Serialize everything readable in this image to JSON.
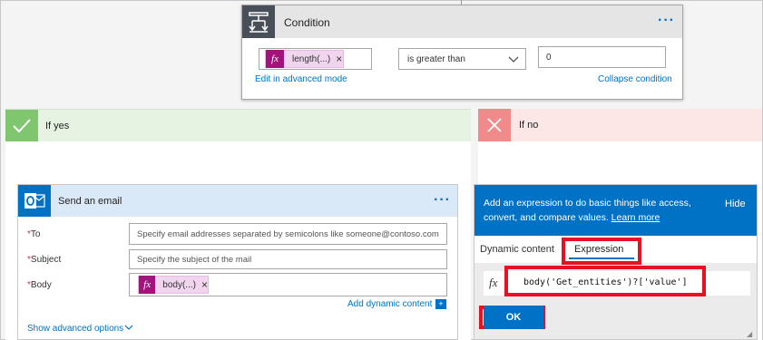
{
  "condition": {
    "title": "Condition",
    "left_token": "length(...)",
    "token_remove": "×",
    "operator": "is greater than",
    "value": "0",
    "edit_link": "Edit in advanced mode",
    "collapse_link": "Collapse condition",
    "more": "···"
  },
  "branches": {
    "yes_label": "If yes",
    "no_label": "If no"
  },
  "email": {
    "title": "Send an email",
    "more": "···",
    "required_mark": "*",
    "to_label": "To",
    "to_placeholder": "Specify email addresses separated by semicolons like someone@contoso.com",
    "subject_label": "Subject",
    "subject_placeholder": "Specify the subject of the mail",
    "body_label": "Body",
    "body_token": "body(...)",
    "token_remove": "×",
    "add_dynamic": "Add dynamic content",
    "show_advanced": "Show advanced options"
  },
  "panel": {
    "description": "Add an expression to do basic things like access, convert, and compare values.",
    "learn_more": "Learn more",
    "hide": "Hide",
    "tab_dynamic": "Dynamic content",
    "tab_expression": "Expression",
    "expression": "body('Get_entities')?['value']",
    "ok": "OK"
  },
  "colors": {
    "accent": "#0072c6",
    "yes": "#7fc66f",
    "no": "#f18a8a",
    "token": "#a4137c",
    "highlight": "#e81123"
  }
}
